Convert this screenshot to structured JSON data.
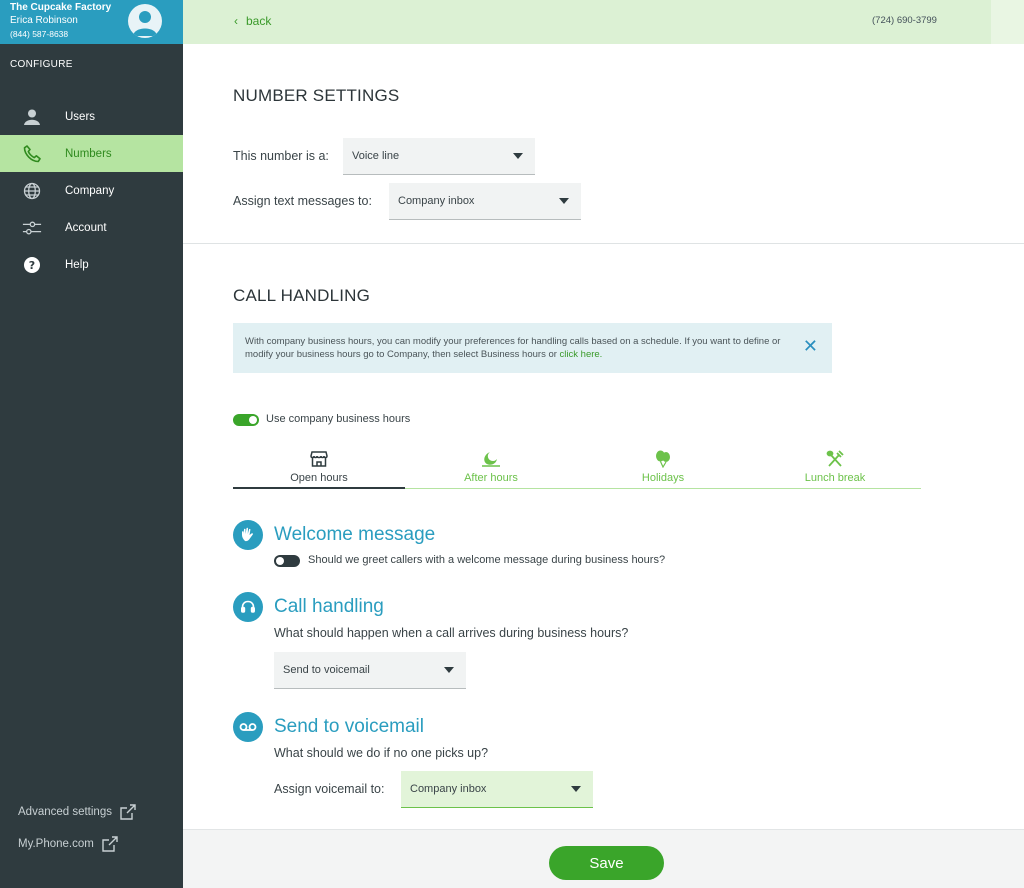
{
  "account": {
    "company": "The Cupcake Factory",
    "user": "Erica Robinson",
    "phone": "(844) 587-8638"
  },
  "sidebar": {
    "section": "CONFIGURE",
    "items": [
      {
        "label": "Users",
        "icon": "user-icon"
      },
      {
        "label": "Numbers",
        "icon": "phone-icon"
      },
      {
        "label": "Company",
        "icon": "globe-icon"
      },
      {
        "label": "Account",
        "icon": "sliders-icon"
      },
      {
        "label": "Help",
        "icon": "help-icon"
      }
    ],
    "footer": {
      "advanced": "Advanced settings",
      "myphone": "My.Phone.com"
    }
  },
  "topbar": {
    "back": "back",
    "number": "(724) 690-3799"
  },
  "number_settings": {
    "title": "NUMBER SETTINGS",
    "type_label": "This number is a:",
    "type_value": "Voice line",
    "texts_label": "Assign text messages to:",
    "texts_value": "Company inbox"
  },
  "call_handling": {
    "title": "CALL HANDLING",
    "info_text": "With company business hours, you can modify your preferences for handling calls based on a schedule. If you want to define or modify your business hours go to Company, then select Business hours or ",
    "info_link": "click here.",
    "use_hours_label": "Use company business hours",
    "use_hours_on": true,
    "tabs": [
      {
        "label": "Open hours",
        "icon": "store-icon"
      },
      {
        "label": "After hours",
        "icon": "moon-icon"
      },
      {
        "label": "Holidays",
        "icon": "balloons-icon"
      },
      {
        "label": "Lunch break",
        "icon": "utensils-icon"
      }
    ],
    "active_tab": "Open hours"
  },
  "welcome": {
    "title": "Welcome message",
    "toggle_label": "Should we greet callers with a welcome message during business hours?",
    "toggle_on": false
  },
  "handling": {
    "title": "Call handling",
    "question": "What should happen when a call arrives during business hours?",
    "value": "Send to voicemail"
  },
  "voicemail": {
    "title": "Send to voicemail",
    "question": "What should we do if no one picks up?",
    "assign_label": "Assign voicemail to:",
    "assign_value": "Company inbox"
  },
  "save_label": "Save",
  "colors": {
    "sidebar": "#2f3b3f",
    "accent_blue": "#2a9dbf",
    "accent_green": "#3aa52a",
    "active_nav": "#b5e4a1"
  }
}
